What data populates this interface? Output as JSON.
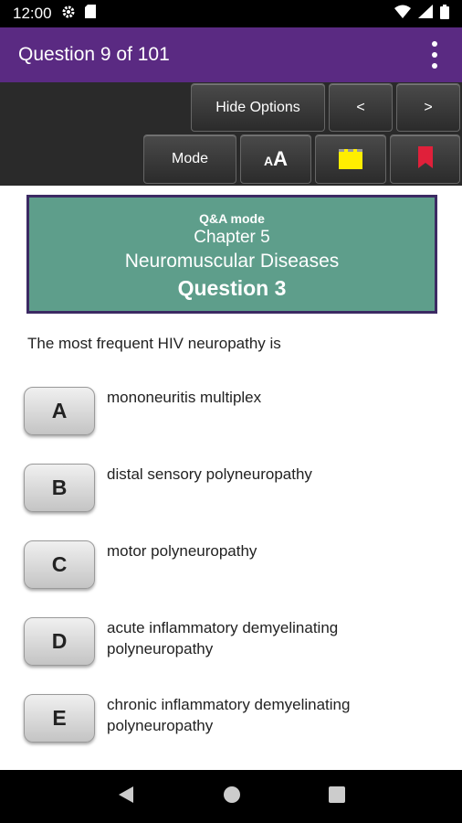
{
  "status": {
    "time": "12:00"
  },
  "app_bar": {
    "title": "Question 9 of 101"
  },
  "toolbar": {
    "hide_options_label": "Hide Options",
    "prev_label": "<",
    "next_label": ">",
    "mode_label": "Mode",
    "font_size_label": "AA",
    "note_color": "#ffee00",
    "bookmark_color": "#e0203a"
  },
  "card": {
    "mode": "Q&A mode",
    "chapter": "Chapter 5",
    "topic": "Neuromuscular Diseases",
    "question_number": "Question 3"
  },
  "question": "The most frequent HIV neuropathy is",
  "options": [
    {
      "letter": "A",
      "text": "mononeuritis multiplex"
    },
    {
      "letter": "B",
      "text": "distal sensory polyneuropathy"
    },
    {
      "letter": "C",
      "text": "motor polyneuropathy"
    },
    {
      "letter": "D",
      "text": "acute inflammatory demyelinating polyneuropathy"
    },
    {
      "letter": "E",
      "text": "chronic inflammatory demyelinating polyneuropathy"
    }
  ]
}
